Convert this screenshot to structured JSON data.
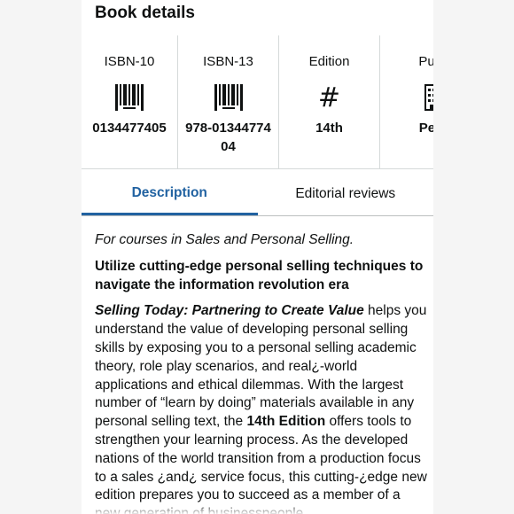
{
  "section_title": "Book details",
  "details": [
    {
      "label": "ISBN-10",
      "icon": "barcode-icon",
      "value": "0134477405"
    },
    {
      "label": "ISBN-13",
      "icon": "barcode-icon",
      "value": "978-0134477404"
    },
    {
      "label": "Edition",
      "icon": "hash-icon",
      "value": "14th"
    },
    {
      "label": "Publi",
      "icon": "building-icon",
      "value": "Pear"
    }
  ],
  "hash_glyph": "#",
  "tabs": [
    {
      "label": "Description",
      "active": true
    },
    {
      "label": "Editorial reviews",
      "active": false
    }
  ],
  "colors": {
    "accent": "#2162a1",
    "text": "#0f1111",
    "divider": "#d5d9d9",
    "background": "#f5f5f5"
  },
  "description": {
    "intro": "For courses in Sales and Personal Selling.",
    "headline": "Utilize cutting-edge personal selling techniques to navigate the information revolution era",
    "book_title": "Selling Today: Partnering to Create Value",
    "body_1": " helps you understand the value of developing personal selling skills by exposing you to a personal selling academic theory, role play scenarios, and real¿-world applications and ethical dilemmas. With the largest number of “learn by doing” materials available in any personal selling text, the ",
    "edition_text": "14th Edition",
    "body_2": " offers tools to strengthen your learning process. As the developed nations of the world transition from a production focus to a sales ¿and¿ service focus, this cutting-¿edge new edition prepares you to succeed as a member of a new generation of businesspeople."
  }
}
